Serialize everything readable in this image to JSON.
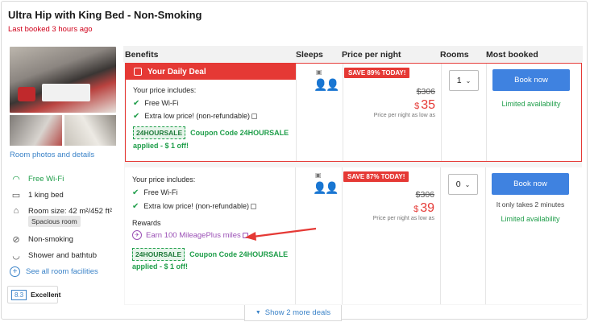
{
  "room": {
    "title": "Ultra Hip with King Bed - Non-Smoking",
    "last_booked": "Last booked 3 hours ago",
    "photos_link": "Room photos and details"
  },
  "columns": {
    "benefits": "Benefits",
    "sleeps": "Sleeps",
    "price": "Price per night",
    "rooms": "Rooms",
    "most_booked": "Most booked"
  },
  "facilities": [
    {
      "label": "Free Wi-Fi",
      "icon": "wifi-icon"
    },
    {
      "label": "1 king bed",
      "icon": "bed-icon"
    },
    {
      "label": "Room size: 42 m²/452 ft²",
      "icon": "room-size-icon"
    },
    {
      "label": "Non-smoking",
      "icon": "no-smoking-icon"
    },
    {
      "label": "Shower and bathtub",
      "icon": "bathtub-icon"
    },
    {
      "label": "See all room facilities",
      "icon": "plus-icon"
    }
  ],
  "room_tag": "Spacious room",
  "review": {
    "score": "8.3",
    "label": "Excellent"
  },
  "deals": [
    {
      "banner": "Your Daily Deal",
      "includes_label": "Your price includes:",
      "benefits": [
        "Free Wi-Fi",
        "Extra low price! (non-refundable)"
      ],
      "coupon_code": "24HOURSALE",
      "coupon_text": "Coupon Code 24HOURSALE",
      "coupon_applied": "applied - $ 1 off!",
      "save_badge": "SAVE 89% TODAY!",
      "old_price": "$306",
      "currency": "$",
      "new_price": "35",
      "price_note": "Price per night as low as",
      "rooms_value": "1",
      "book_label": "Book now",
      "availability": "Limited availability"
    },
    {
      "includes_label": "Your price includes:",
      "benefits": [
        "Free Wi-Fi",
        "Extra low price! (non-refundable)"
      ],
      "rewards_label": "Rewards",
      "rewards_text": "Earn 100 MileagePlus miles",
      "coupon_code": "24HOURSALE",
      "coupon_text": "Coupon Code 24HOURSALE",
      "coupon_applied": "applied - $ 1 off!",
      "save_badge": "SAVE 87% TODAY!",
      "old_price": "$306",
      "currency": "$",
      "new_price": "39",
      "price_note": "Price per night as low as",
      "rooms_value": "0",
      "book_label": "Book now",
      "urgency": "It only takes 2 minutes",
      "availability": "Limited availability"
    }
  ],
  "more_deals": "Show 2 more deals",
  "colors": {
    "accent_red": "#e53935",
    "book_blue": "#3f82e0",
    "green": "#1f9e4a",
    "link_blue": "#3b83c8",
    "rewards_purple": "#9b51b6"
  }
}
